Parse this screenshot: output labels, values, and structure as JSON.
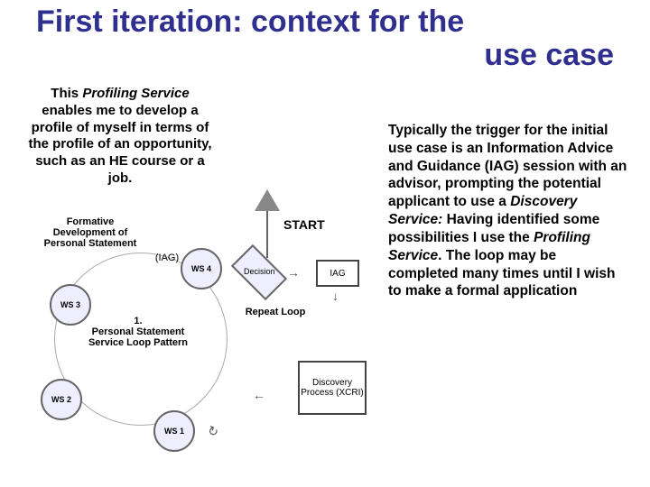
{
  "title": {
    "line1": "First iteration: context for the",
    "line2": "use case"
  },
  "left_blurb": {
    "pre": "This ",
    "service": "Profiling Service",
    "post": " enables me to develop a profile of myself in terms of the profile of an opportunity, such as an HE course or a job."
  },
  "right_blurb": {
    "p1": "Typically the trigger for the initial use case is an Information Advice and Guidance (IAG) session with an advisor, prompting the potential applicant to use a ",
    "disc": "Discovery Service:",
    "p2": " Having identified some possibilities I use the ",
    "prof": "Profiling Service",
    "p3": ".  The loop may be completed many times until I wish to make a formal application"
  },
  "diagram": {
    "start": "START",
    "iag_small": "(IAG)",
    "formative": "Formative Development of Personal Statement",
    "ws1": "WS 1",
    "ws2": "WS 2",
    "ws3": "WS 3",
    "ws4": "WS 4",
    "decision": "Decision",
    "iag_box": "IAG",
    "discovery": "Discovery Process (XCRI)",
    "repeat": "Repeat Loop",
    "loop_title": "1.\nPersonal Statement Service Loop Pattern"
  }
}
